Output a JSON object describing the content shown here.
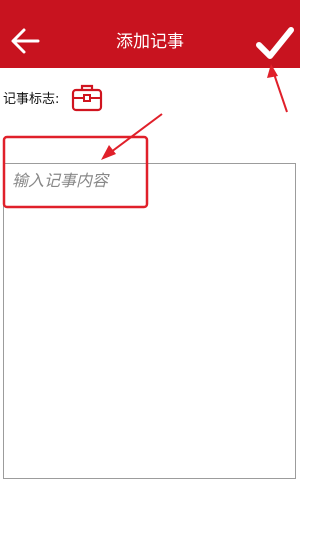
{
  "header": {
    "title": "添加记事",
    "back_icon": "back-arrow-icon",
    "confirm_icon": "checkmark-icon",
    "bar_color": "#c8131f"
  },
  "tag": {
    "label": "记事标志:",
    "icon": "briefcase-icon"
  },
  "editor": {
    "placeholder": "输入记事内容",
    "value": ""
  },
  "annotation": {
    "color": "#e0202a"
  }
}
